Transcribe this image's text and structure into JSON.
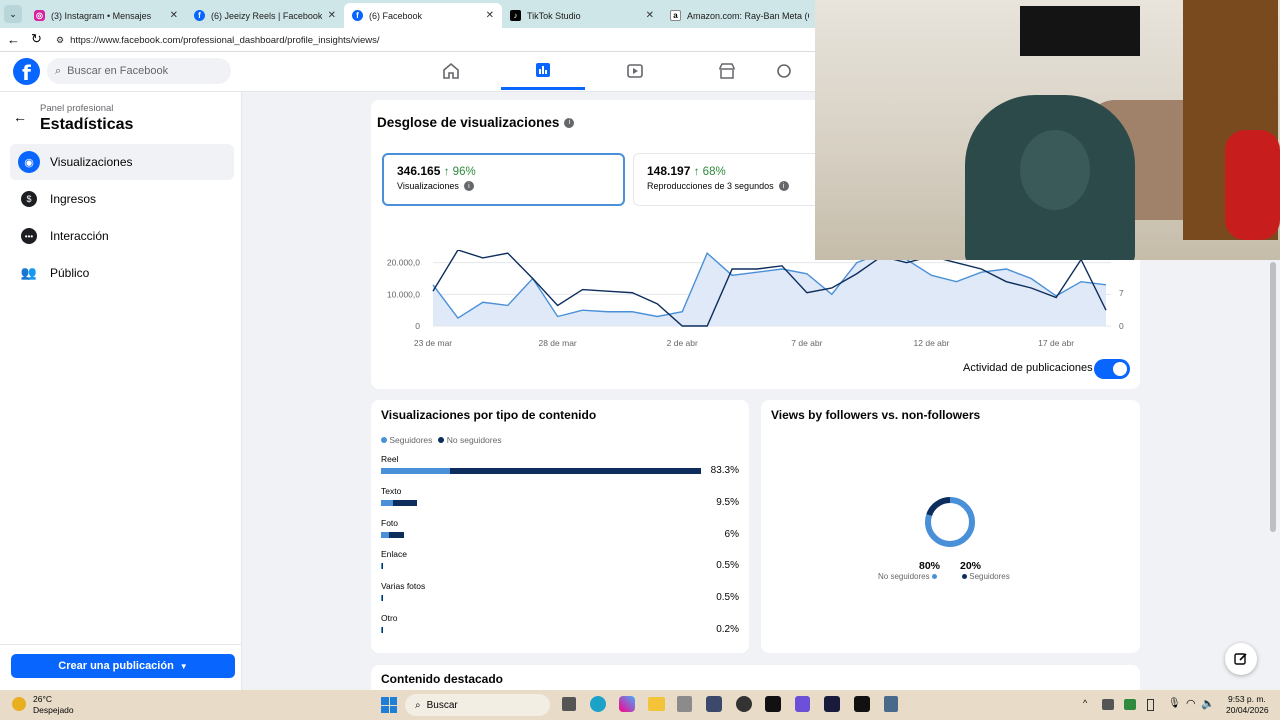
{
  "browser": {
    "tabs": [
      {
        "title": "(3) Instagram • Mensajes",
        "icon": "instagram-icon",
        "color": "#d6249f"
      },
      {
        "title": "(6) Jeeizy Reels | Facebook",
        "icon": "facebook-icon",
        "color": "#0866ff"
      },
      {
        "title": "(6) Facebook",
        "icon": "facebook-icon",
        "color": "#0866ff"
      },
      {
        "title": "TikTok Studio",
        "icon": "tiktok-icon",
        "color": "#000000"
      },
      {
        "title": "Amazon.com: Ray-Ban Meta (Gen",
        "icon": "amazon-icon",
        "color": "#232f3e"
      }
    ],
    "url": "https://www.facebook.com/professional_dashboard/profile_insights/views/"
  },
  "fb": {
    "logo": "f",
    "search_placeholder": "Buscar en Facebook"
  },
  "sidebar": {
    "panel_label": "Panel profesional",
    "title": "Estadísticas",
    "items": [
      {
        "label": "Visualizaciones",
        "icon": "eye-icon"
      },
      {
        "label": "Ingresos",
        "icon": "dollar-icon"
      },
      {
        "label": "Interacción",
        "icon": "chat-icon"
      },
      {
        "label": "Público",
        "icon": "people-icon"
      }
    ],
    "create_button": "Crear una publicación"
  },
  "breakdown": {
    "title": "Desglose de visualizaciones",
    "metric1_value": "346.165",
    "metric1_change": "↑ 96%",
    "metric1_label": "Visualizaciones",
    "metric2_value": "148.197",
    "metric2_change": "↑ 68%",
    "metric2_label": "Reproducciones de 3 segundos",
    "toggle_label": "Actividad de publicaciones"
  },
  "chart_data": [
    {
      "type": "line",
      "x": [
        "23 de mar",
        "24 de mar",
        "25 de mar",
        "26 de mar",
        "27 de mar",
        "28 de mar",
        "29 de mar",
        "30 de mar",
        "31 de mar",
        "1 de abr",
        "2 de abr",
        "3 de abr",
        "4 de abr",
        "5 de abr",
        "6 de abr",
        "7 de abr",
        "8 de abr",
        "9 de abr",
        "10 de abr",
        "11 de abr",
        "12 de abr",
        "13 de abr",
        "14 de abr",
        "15 de abr",
        "16 de abr",
        "17 de abr",
        "18 de abr",
        "19 de abr"
      ],
      "x_ticks": [
        "23 de mar",
        "28 de mar",
        "2 de abr",
        "7 de abr",
        "12 de abr",
        "17 de abr"
      ],
      "y_ticks_left": [
        "0",
        "10.000,0",
        "20.000,0"
      ],
      "y_ticks_right": [
        "0",
        "7"
      ],
      "ylim": [
        0,
        24000
      ],
      "series": [
        {
          "values": [
            13000,
            2500,
            7500,
            6500,
            15000,
            3000,
            5000,
            4500,
            4500,
            3000,
            4500,
            23000,
            16000,
            17000,
            18000,
            16500,
            10000,
            20000,
            23000,
            21000,
            16000,
            14000,
            17000,
            18000,
            15000,
            9500,
            14000,
            13000
          ]
        },
        {
          "values": [
            11000,
            24000,
            21500,
            23000,
            15000,
            6500,
            11500,
            11000,
            10500,
            7000,
            0,
            0,
            18000,
            18000,
            19000,
            10500,
            12000,
            16500,
            22000,
            20000,
            22000,
            20000,
            18000,
            14000,
            12000,
            9000,
            21000,
            5000
          ]
        }
      ]
    },
    {
      "type": "bar",
      "categories": [
        "Reel",
        "Texto",
        "Foto",
        "Enlace",
        "Varias fotos",
        "Otro"
      ],
      "labels": [
        "83.3%",
        "9.5%",
        "6%",
        "0.5%",
        "0.5%",
        "0.2%"
      ],
      "series": [
        {
          "name": "Seguidores",
          "values": [
            18,
            3,
            2,
            0.2,
            0.2,
            0.1
          ]
        },
        {
          "name": "No seguidores",
          "values": [
            65.3,
            6.5,
            4,
            0.3,
            0.3,
            0.1
          ]
        }
      ],
      "title": "Visualizaciones por tipo de contenido"
    },
    {
      "type": "pie",
      "title": "Views by followers vs. non-followers",
      "categories": [
        "No seguidores",
        "Seguidores"
      ],
      "values": [
        80,
        20
      ],
      "labels": [
        "80%",
        "20%"
      ]
    }
  ],
  "content_type": {
    "title": "Visualizaciones por tipo de contenido",
    "legend_followers": "Seguidores",
    "legend_nonfollowers": "No seguidores"
  },
  "followers_card": {
    "title": "Views by followers vs. non-followers",
    "nonfollowers_pct": "80%",
    "nonfollowers_label": "No seguidores",
    "followers_pct": "20%",
    "followers_label": "Seguidores"
  },
  "featured": {
    "title": "Contenido destacado"
  },
  "colors": {
    "followers": "#4a90d9",
    "nonfollowers": "#0d2d5c",
    "accent": "#0866ff"
  },
  "taskbar": {
    "temp": "26°C",
    "weather": "Despejado",
    "search": "Buscar",
    "time": "9:53 p. m.",
    "date": "20/04/2026"
  }
}
